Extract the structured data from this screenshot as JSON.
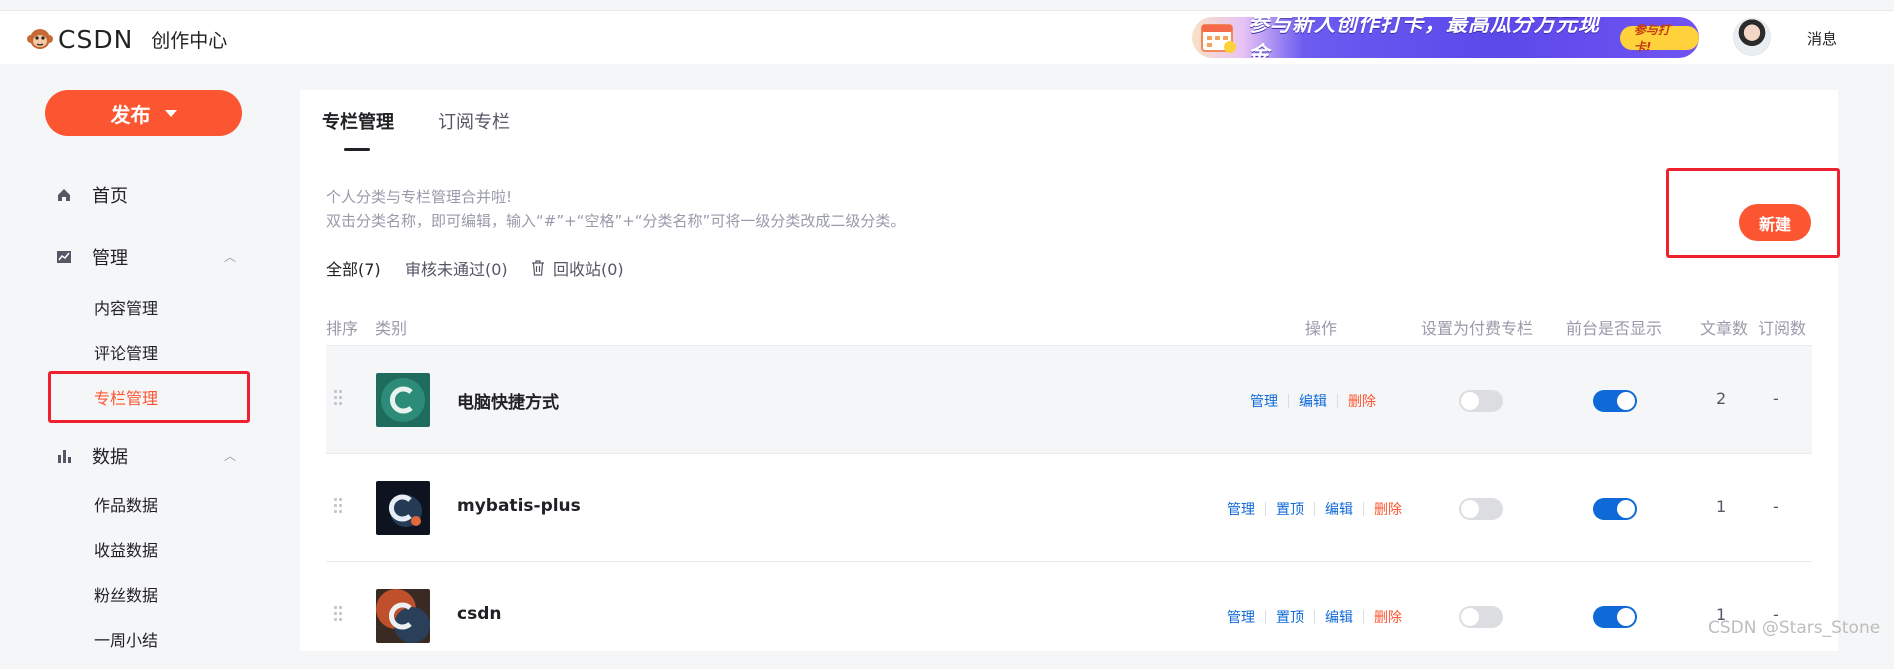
{
  "header": {
    "logo_text": "CSDN",
    "app_title": "创作中心",
    "banner_text": "参与新人创作打卡，最高瓜分万元现金",
    "banner_button": "参与打卡!",
    "messages_label": "消息"
  },
  "sidebar": {
    "publish_label": "发布",
    "home_label": "首页",
    "manage_label": "管理",
    "manage_items": [
      "内容管理",
      "评论管理",
      "专栏管理"
    ],
    "data_label": "数据",
    "data_items": [
      "作品数据",
      "收益数据",
      "粉丝数据",
      "一周小结"
    ]
  },
  "main": {
    "tabs": [
      "专栏管理",
      "订阅专栏"
    ],
    "tip_line1": "个人分类与专栏管理合并啦!",
    "tip_line2": "双击分类名称，即可编辑，输入“#”+“空格”+“分类名称”可将一级分类改成二级分类。",
    "new_button": "新建",
    "filters": [
      "全部(7)",
      "审核未通过(0)",
      "回收站(0)"
    ],
    "columns": {
      "order": "排序",
      "category": "类别",
      "actions": "操作",
      "paid": "设置为付费专栏",
      "visible": "前台是否显示",
      "articles": "文章数",
      "subscribers": "订阅数"
    },
    "rows": [
      {
        "name": "电脑快捷方式",
        "actions": [
          "管理",
          "编辑",
          "删除"
        ],
        "paid": false,
        "visible": true,
        "articles": "2",
        "subscribers": "-"
      },
      {
        "name": "mybatis-plus",
        "actions": [
          "管理",
          "置顶",
          "编辑",
          "删除"
        ],
        "paid": false,
        "visible": true,
        "articles": "1",
        "subscribers": "-"
      },
      {
        "name": "csdn",
        "actions": [
          "管理",
          "置顶",
          "编辑",
          "删除"
        ],
        "paid": false,
        "visible": true,
        "articles": "1",
        "subscribers": "-"
      }
    ]
  },
  "watermark": "CSDN @Stars_Stone",
  "colors": {
    "accent": "#fc5531",
    "link": "#0f6ad8",
    "highlight_box": "#f0212e"
  }
}
